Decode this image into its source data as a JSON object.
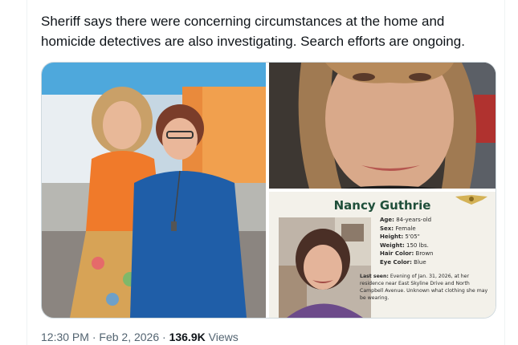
{
  "tweet": {
    "text": "Sheriff says there were concerning circumstances at the home and homicide detectives are also investigating. Search efforts are ongoing."
  },
  "media": {
    "photo_left": {
      "icon": "studio-photo-two-women"
    },
    "photo_top_right": {
      "icon": "closeup-portrait-woman"
    },
    "poster": {
      "name": "Nancy Guthrie",
      "age_label": "Age:",
      "age_value": "84-years-old",
      "sex_label": "Sex:",
      "sex_value": "Female",
      "height_label": "Height:",
      "height_value": "5'05\"",
      "weight_label": "Weight:",
      "weight_value": "150 lbs.",
      "hair_label": "Hair Color:",
      "hair_value": "Brown",
      "eye_label": "Eye Color:",
      "eye_value": "Blue",
      "last_seen_label": "Last seen:",
      "last_seen_text": "Evening of Jan. 31, 2026, at her residence near East Skyline Drive and North Campbell Avenue. Unknown what clothing she may be wearing."
    }
  },
  "meta": {
    "time": "12:30 PM",
    "separator": "·",
    "date": "Feb 2, 2026",
    "views_count": "136.9K",
    "views_label": "Views"
  },
  "colors": {
    "text_primary": "#0f1419",
    "text_secondary": "#536471",
    "poster_name": "#1f4f3a"
  }
}
